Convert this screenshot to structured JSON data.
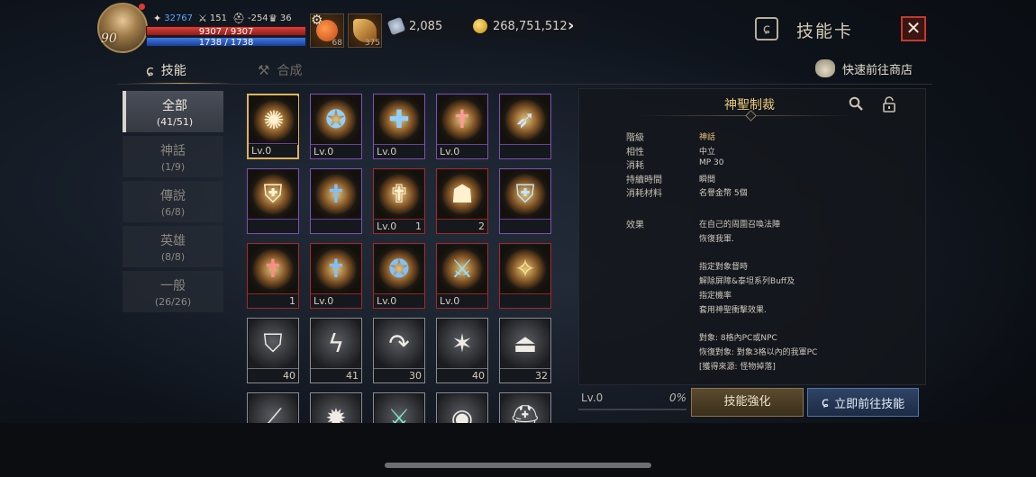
{
  "player": {
    "level": "90",
    "stats": [
      {
        "icon": "power-icon",
        "value": "32767"
      },
      {
        "icon": "sword-icon",
        "value": "151"
      },
      {
        "icon": "helmet-icon",
        "value": "-254"
      },
      {
        "icon": "trophy-icon",
        "value": "36"
      }
    ],
    "hp": "9307 / 9307",
    "mp": "1738 / 1738"
  },
  "items": {
    "potion_count": "68",
    "scroll_count": "375"
  },
  "currency": {
    "crystal": "2,085",
    "gold": "268,751,512"
  },
  "header": {
    "title": "技能卡",
    "close": "✕"
  },
  "tabs": [
    {
      "label": "技能",
      "active": true
    },
    {
      "label": "合成",
      "active": false
    }
  ],
  "shop_link": "快速前往商店",
  "categories": [
    {
      "name": "全部",
      "count": "(41/51)",
      "active": true
    },
    {
      "name": "神話",
      "count": "(1/9)"
    },
    {
      "name": "傳說",
      "count": "(6/8)"
    },
    {
      "name": "英雄",
      "count": "(8/8)"
    },
    {
      "name": "一般",
      "count": "(26/26)"
    }
  ],
  "skills": [
    {
      "icon": "holy-burst-icon",
      "rarity": "myth",
      "level": "Lv.0",
      "count": ""
    },
    {
      "icon": "holy-star-icon",
      "rarity": "myth",
      "level": "Lv.0",
      "count": ""
    },
    {
      "icon": "holy-shield-icon",
      "rarity": "myth",
      "level": "Lv.0",
      "count": ""
    },
    {
      "icon": "holy-book-icon",
      "rarity": "myth",
      "level": "Lv.0",
      "count": ""
    },
    {
      "icon": "lightning-strike-icon",
      "rarity": "myth",
      "level": "",
      "count": ""
    },
    {
      "icon": "crest-shield-icon",
      "rarity": "myth",
      "level": "",
      "count": ""
    },
    {
      "icon": "blue-tome-icon",
      "rarity": "myth",
      "level": "",
      "count": ""
    },
    {
      "icon": "holy-cross-icon",
      "rarity": "leg",
      "level": "Lv.0",
      "count": "1"
    },
    {
      "icon": "praying-hands-icon",
      "rarity": "leg",
      "level": "",
      "count": "2"
    },
    {
      "icon": "ice-crest-icon",
      "rarity": "myth",
      "level": "",
      "count": ""
    },
    {
      "icon": "red-tome-icon",
      "rarity": "leg",
      "level": "",
      "count": "1"
    },
    {
      "icon": "blue-tome-icon",
      "rarity": "leg",
      "level": "Lv.0",
      "count": ""
    },
    {
      "icon": "holy-ring-icon",
      "rarity": "leg",
      "level": "Lv.0",
      "count": ""
    },
    {
      "icon": "ice-sword-icon",
      "rarity": "leg",
      "level": "Lv.0",
      "count": ""
    },
    {
      "icon": "exp-icon",
      "rarity": "leg",
      "level": "",
      "count": ""
    },
    {
      "icon": "shield-icon",
      "rarity": "plain",
      "level": "",
      "count": "40"
    },
    {
      "icon": "lightning-icon",
      "rarity": "plain",
      "level": "",
      "count": "41"
    },
    {
      "icon": "arc-arrow-icon",
      "rarity": "plain",
      "level": "",
      "count": "30"
    },
    {
      "icon": "impact-icon",
      "rarity": "plain",
      "level": "",
      "count": "40"
    },
    {
      "icon": "weight-icon",
      "rarity": "plain",
      "level": "",
      "count": "32"
    },
    {
      "icon": "blade-icon",
      "rarity": "plain",
      "level": "",
      "count": ""
    },
    {
      "icon": "gear-burst-icon",
      "rarity": "plain",
      "level": "",
      "count": ""
    },
    {
      "icon": "twin-swords-icon",
      "rarity": "plain",
      "level": "",
      "count": ""
    },
    {
      "icon": "orb-icon",
      "rarity": "plain",
      "level": "",
      "count": ""
    },
    {
      "icon": "helmet-icon",
      "rarity": "plain",
      "level": "",
      "count": ""
    }
  ],
  "detail": {
    "name": "神聖制裁",
    "attributes": [
      {
        "label": "階級",
        "value": "神話",
        "gold": true
      },
      {
        "label": "相性",
        "value": "中立"
      },
      {
        "label": "消耗",
        "value": "MP 30"
      },
      {
        "label": "持續時間",
        "value": "瞬間"
      },
      {
        "label": "消耗材料",
        "value": "名譽金幣 5個"
      }
    ],
    "effect_label": "效果",
    "effect_lines": [
      "在自己的周圍召喚法陣",
      "恢復我軍.",
      "",
      "指定對象督時",
      "解除屏障&泰坦系列Buff及",
      "指定機率",
      "套用神聖衝擊效果.",
      "",
      "對象: 8格內PC或NPC",
      "恢復對象: 對象3格以內的我軍PC",
      "[獲得來源: 怪物掉落]"
    ],
    "level": "Lv.0",
    "progress": "0%",
    "enhance_button": "技能強化",
    "goto_button": "立即前往技能"
  },
  "colors": {
    "gold_text": "#e7c97a",
    "myth_border": "#7f4fb0",
    "legend_border": "#a32a26",
    "close_red": "#c23a2e",
    "hp_red": "#d9413a",
    "mp_blue": "#3f7ae0"
  }
}
